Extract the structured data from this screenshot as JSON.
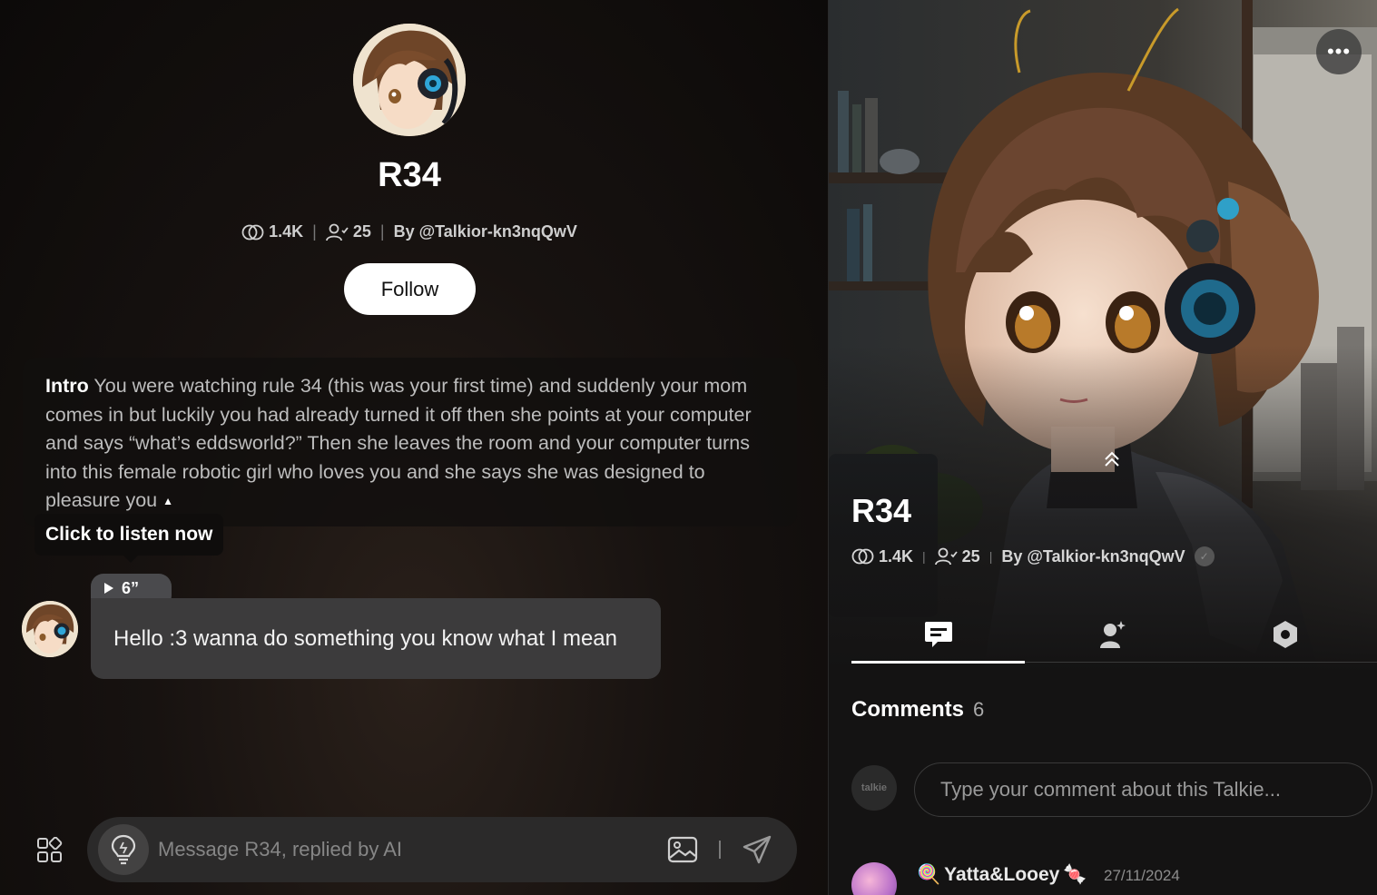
{
  "bot": {
    "name": "R34",
    "chats": "1.4K",
    "followers": "25",
    "author": "By @Talkior-kn3nqQwV"
  },
  "follow_label": "Follow",
  "intro": {
    "label": "Intro",
    "text": " You were watching rule 34 (this was your first time) and suddenly your mom comes in but luckily you had already turned it off then she points at your computer and says “what’s eddsworld?” Then she leaves the room and your computer turns into this female robotic girl who loves you and she says she was designed to pleasure you",
    "collapse_icon": "caret-up-icon"
  },
  "listen_tooltip": "Click to listen now",
  "message": {
    "voice_duration": "6”",
    "text": "Hello :3 wanna do something you know what I mean"
  },
  "composer": {
    "placeholder": "Message R34, replied by AI"
  },
  "side": {
    "more_label": "•••",
    "tabs": [
      {
        "name": "comments",
        "icon": "chat-bubble-icon"
      },
      {
        "name": "characters",
        "icon": "character-sparkle-icon"
      },
      {
        "name": "settings",
        "icon": "hexagon-gear-icon"
      }
    ],
    "comments_label": "Comments",
    "comments_count": "6",
    "user_avatar_text": "talkie",
    "comment_placeholder": "Type your comment about this Talkie...",
    "comments": [
      {
        "name": "Yatta&Looey",
        "date": "27/11/2024"
      }
    ]
  },
  "colors": {
    "background": "#0b0a0a",
    "bubble": "#3c3b3c",
    "voice_chip": "#4a4a4d",
    "composer": "#2b2a2a",
    "panel": "#141313",
    "accent": "#ffffff"
  }
}
